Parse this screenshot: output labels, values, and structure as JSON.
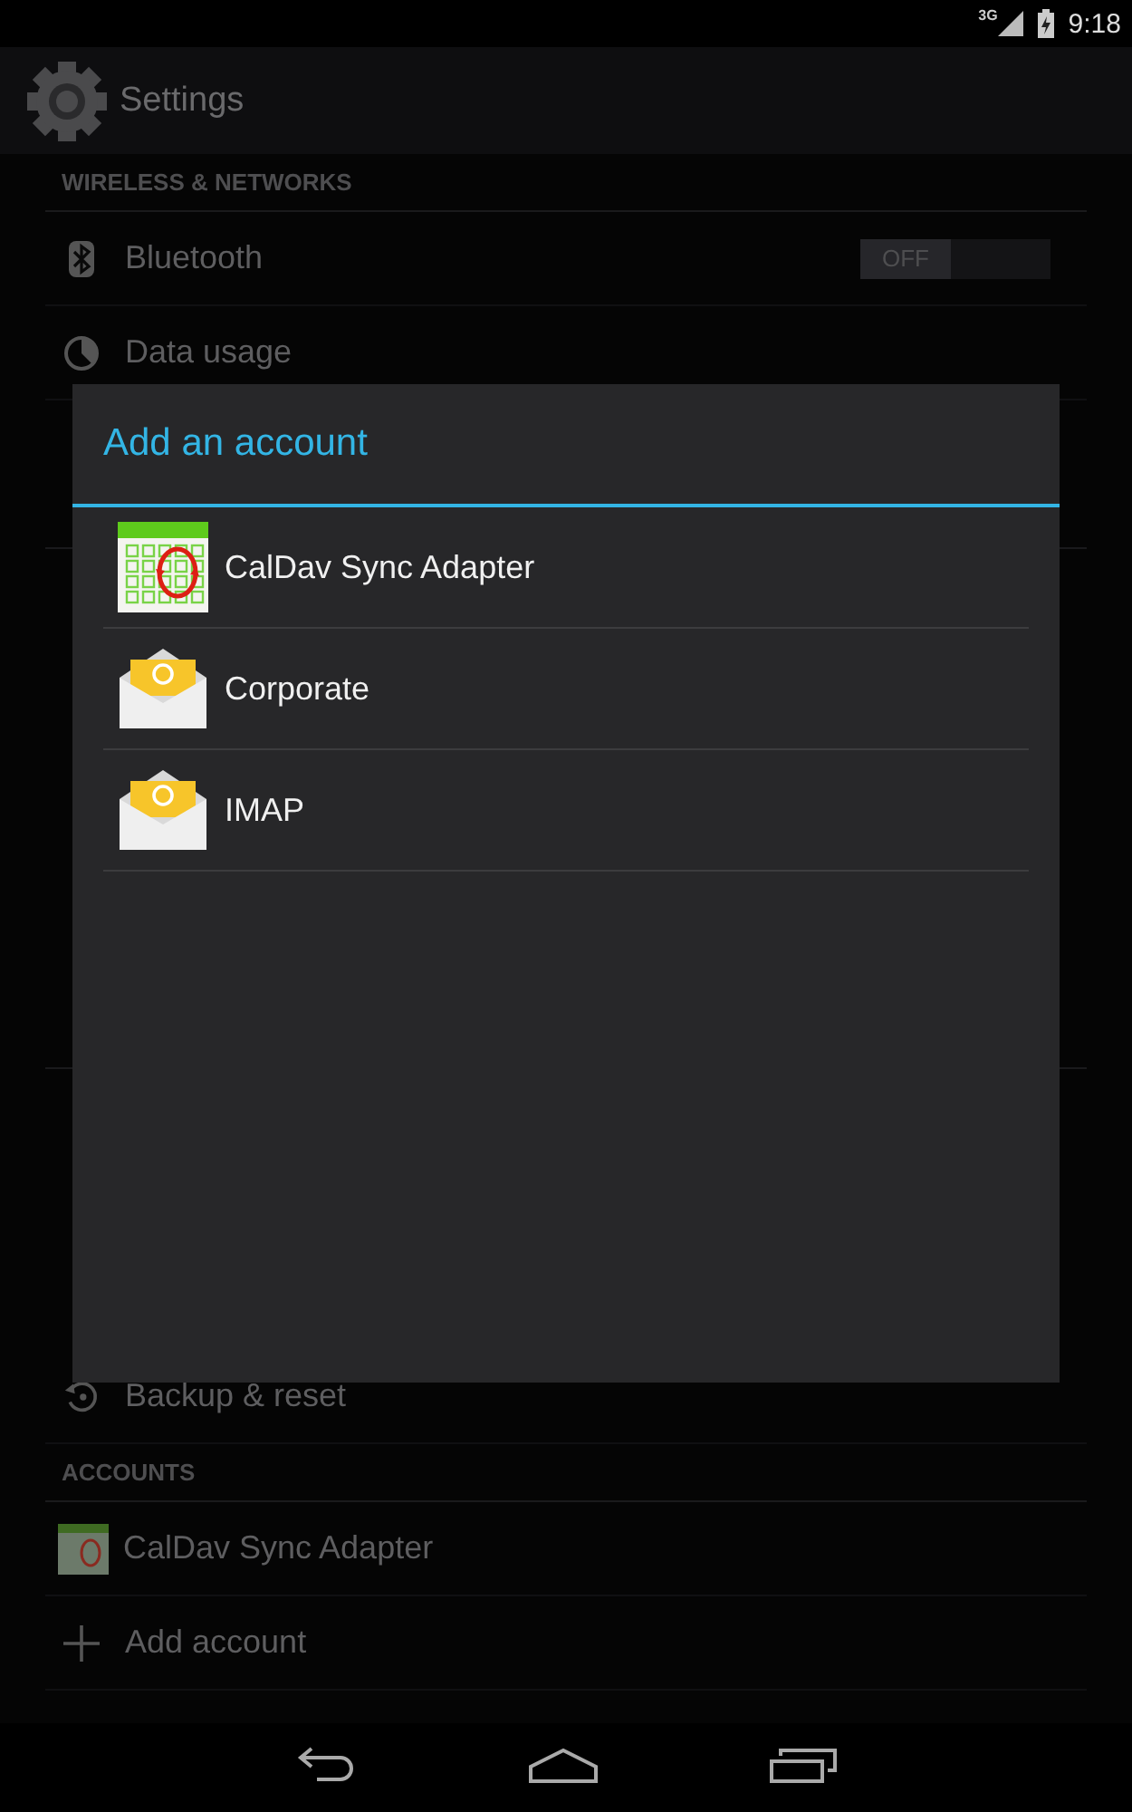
{
  "status_bar": {
    "network": "3G",
    "time": "9:18"
  },
  "action_bar": {
    "title": "Settings"
  },
  "settings": {
    "wireless_header": "WIRELESS & NETWORKS",
    "bluetooth": {
      "label": "Bluetooth",
      "switch": {
        "label": "OFF",
        "on": false
      }
    },
    "data_usage": {
      "label": "Data usage"
    },
    "backup": {
      "label": "Backup & reset"
    },
    "accounts_header": "ACCOUNTS",
    "accounts": [
      {
        "label": "CalDav Sync Adapter"
      }
    ],
    "add_account": {
      "label": "Add account"
    }
  },
  "dialog": {
    "title": "Add an account",
    "items": [
      {
        "label": "CalDav Sync Adapter",
        "kind": "calendar"
      },
      {
        "label": "Corporate",
        "kind": "email"
      },
      {
        "label": "IMAP",
        "kind": "email"
      }
    ]
  }
}
